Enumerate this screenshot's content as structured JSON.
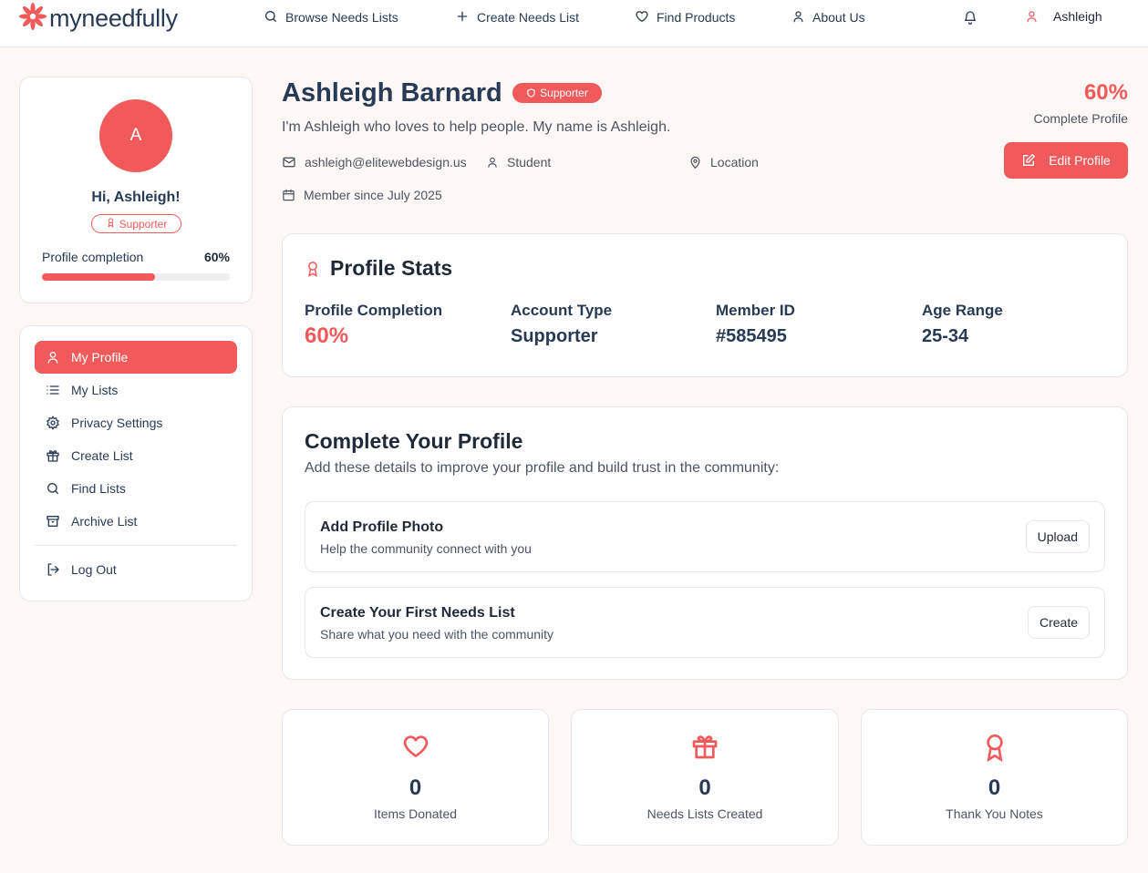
{
  "colors": {
    "accent": "#f05a5a",
    "navy": "#283a55",
    "background": "#fdf8f5"
  },
  "brand": {
    "name": "myneedfully",
    "icon": "sun-flower-logo-icon"
  },
  "nav": {
    "items": [
      {
        "label": "Browse Needs Lists",
        "icon": "search-icon"
      },
      {
        "label": "Create Needs List",
        "icon": "plus-icon"
      },
      {
        "label": "Find Products",
        "icon": "heart-icon"
      },
      {
        "label": "About Us",
        "icon": "user-icon"
      }
    ],
    "notifications_icon": "bell-icon",
    "user_name": "Ashleigh"
  },
  "profile_card": {
    "avatar_initial": "A",
    "greeting": "Hi, Ashleigh!",
    "badge": "Supporter",
    "completion_label": "Profile completion",
    "completion_value": "60%",
    "completion_fraction": 0.6
  },
  "sidebar": {
    "items": [
      {
        "label": "My Profile",
        "icon": "user-icon",
        "active": true
      },
      {
        "label": "My Lists",
        "icon": "list-icon"
      },
      {
        "label": "Privacy Settings",
        "icon": "gear-icon"
      },
      {
        "label": "Create List",
        "icon": "gift-icon"
      },
      {
        "label": "Find Lists",
        "icon": "search-icon"
      },
      {
        "label": "Archive List",
        "icon": "archive-icon"
      }
    ],
    "logout": "Log Out"
  },
  "header": {
    "name": "Ashleigh Barnard",
    "badge": "Supporter",
    "bio": "I'm Ashleigh who loves to help people. My name is Ashleigh.",
    "email": "ashleigh@elitewebdesign.us",
    "role": "Student",
    "location": "Location",
    "member_since": "Member since July 2025",
    "completion_percent": "60%",
    "completion_label": "Complete Profile",
    "edit_button": "Edit Profile"
  },
  "stats": {
    "title": "Profile Stats",
    "items": [
      {
        "label": "Profile Completion",
        "value": "60%"
      },
      {
        "label": "Account Type",
        "value": "Supporter"
      },
      {
        "label": "Member ID",
        "value": "#585495"
      },
      {
        "label": "Age Range",
        "value": "25-34"
      }
    ]
  },
  "complete_profile": {
    "title": "Complete Your Profile",
    "subtitle": "Add these details to improve your profile and build trust in the community:",
    "tasks": [
      {
        "title": "Add Profile Photo",
        "subtitle": "Help the community connect with you",
        "button": "Upload"
      },
      {
        "title": "Create Your First Needs List",
        "subtitle": "Share what you need with the community",
        "button": "Create"
      }
    ]
  },
  "tiles": [
    {
      "count": "0",
      "label": "Items Donated",
      "icon": "heart-icon"
    },
    {
      "count": "0",
      "label": "Needs Lists Created",
      "icon": "gift-icon"
    },
    {
      "count": "0",
      "label": "Thank You Notes",
      "icon": "award-icon"
    }
  ]
}
